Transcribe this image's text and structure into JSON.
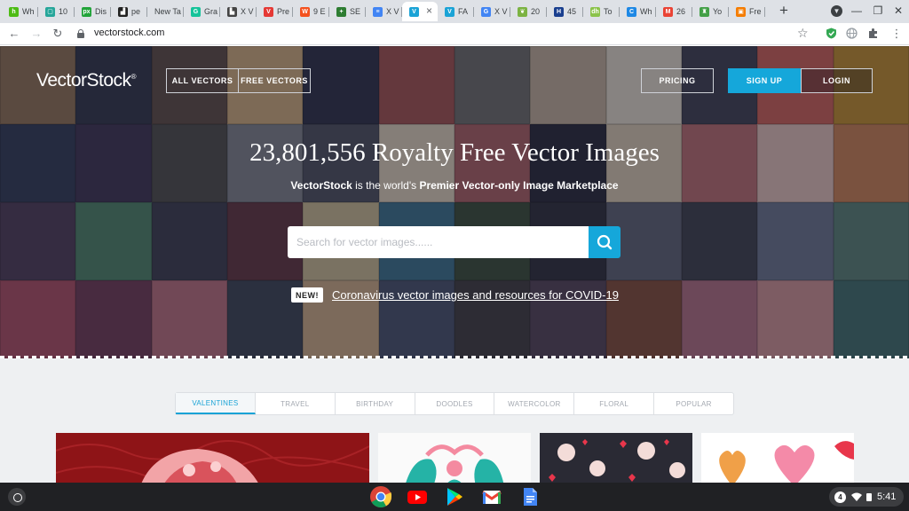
{
  "browser": {
    "tabs": [
      {
        "label": "Wh",
        "icon": "houzz-icon",
        "color": "#4dbc15",
        "glyph": "h"
      },
      {
        "label": "10",
        "icon": "list-icon",
        "color": "#26a69a",
        "glyph": "▢"
      },
      {
        "label": "Dis",
        "icon": "px-icon",
        "color": "#22a43a",
        "glyph": "px"
      },
      {
        "label": "pe",
        "icon": "photo-icon",
        "color": "#222222",
        "glyph": "▟"
      },
      {
        "label": "New Ta",
        "icon": "",
        "color": "",
        "glyph": ""
      },
      {
        "label": "Gra",
        "icon": "grammarly-icon",
        "color": "#15c39a",
        "glyph": "G"
      },
      {
        "label": "X V",
        "icon": "chart-icon",
        "color": "#444444",
        "glyph": "▙"
      },
      {
        "label": "Pre",
        "icon": "v-icon",
        "color": "#e53935",
        "glyph": "V"
      },
      {
        "label": "9 E",
        "icon": "w-icon",
        "color": "#f4511e",
        "glyph": "W"
      },
      {
        "label": "SE",
        "icon": "plus-icon",
        "color": "#2e7d32",
        "glyph": "+"
      },
      {
        "label": "X V",
        "icon": "docs-icon",
        "color": "#4285f4",
        "glyph": "≡"
      },
      {
        "label": "",
        "icon": "vectorstock-icon",
        "color": "#1aa3d6",
        "glyph": "V",
        "active": true
      },
      {
        "label": "FA",
        "icon": "vectorstock-icon",
        "color": "#1aa3d6",
        "glyph": "V"
      },
      {
        "label": "X V",
        "icon": "google-icon",
        "color": "#4285f4",
        "glyph": "G"
      },
      {
        "label": "20",
        "icon": "leaf-icon",
        "color": "#7cb342",
        "glyph": "❦"
      },
      {
        "label": "45",
        "icon": "h-icon",
        "color": "#1a3f8f",
        "glyph": "H"
      },
      {
        "label": "To",
        "icon": "dh-icon",
        "color": "#8bc34a",
        "glyph": "dh"
      },
      {
        "label": "Wh",
        "icon": "grammarly-icon",
        "color": "#1e88e5",
        "glyph": "C"
      },
      {
        "label": "26",
        "icon": "gmail-icon",
        "color": "#ea4335",
        "glyph": "M"
      },
      {
        "label": "Yo",
        "icon": "shirt-icon",
        "color": "#43a047",
        "glyph": "♜"
      },
      {
        "label": "Fre",
        "icon": "orange-icon",
        "color": "#f57c00",
        "glyph": "▣"
      }
    ],
    "url": "vectorstock.com"
  },
  "site": {
    "logo": "VectorStock",
    "logo_mark": "®",
    "nav": {
      "all_vectors": "ALL VECTORS",
      "free_vectors": "FREE VECTORS",
      "pricing": "PRICING",
      "sign_up": "SIGN UP",
      "login": "LOGIN"
    },
    "headline": "23,801,556 Royalty Free Vector Images",
    "subline": {
      "brand": "VectorStock",
      "middle": " is the world's ",
      "emphasis": "Premier Vector-only Image Marketplace"
    },
    "search": {
      "placeholder": "Search for vector images......"
    },
    "badge": "NEW!",
    "covid_link": "Coronavirus vector images and resources for COVID-19",
    "categories": [
      {
        "label": "VALENTINES",
        "active": true
      },
      {
        "label": "TRAVEL"
      },
      {
        "label": "BIRTHDAY"
      },
      {
        "label": "DOODLES"
      },
      {
        "label": "WATERCOLOR"
      },
      {
        "label": "FLORAL"
      },
      {
        "label": "POPULAR"
      }
    ]
  },
  "shelf": {
    "apps": [
      "chrome-icon",
      "youtube-icon",
      "play-store-icon",
      "gmail-icon",
      "docs-icon"
    ],
    "notification_count": "4",
    "time": "5:41"
  },
  "colors": {
    "accent": "#15a7da",
    "active_category": "#1aa3d6",
    "shelf": "#202124"
  }
}
